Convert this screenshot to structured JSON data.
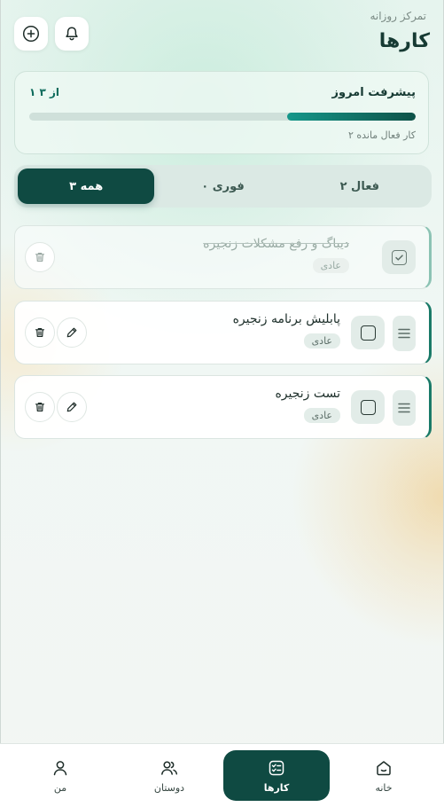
{
  "header": {
    "subtitle": "تمرکز روزانه",
    "title": "کارها",
    "add_icon": "plus-circle-icon",
    "bell_icon": "bell-icon"
  },
  "progress": {
    "title": "پیشرفت امروز",
    "count_text": "۱ از ۳",
    "completed": 1,
    "total": 3,
    "remaining_text": "۲ کار فعال مانده"
  },
  "tabs": [
    {
      "label": "فعال ۲",
      "active": false
    },
    {
      "label": "فوری ۰",
      "active": false
    },
    {
      "label": "همه ۳",
      "active": true
    }
  ],
  "tasks": [
    {
      "title": "دیباگ و رفع مشکلات زنجیره",
      "badge": "عادی",
      "done": true
    },
    {
      "title": "پابلیش برنامه زنجیره",
      "badge": "عادی",
      "done": false
    },
    {
      "title": "تست زنجیره",
      "badge": "عادی",
      "done": false
    }
  ],
  "nav": [
    {
      "label": "خانه",
      "icon": "home-icon",
      "active": false
    },
    {
      "label": "کارها",
      "icon": "tasks-icon",
      "active": true
    },
    {
      "label": "دوستان",
      "icon": "friends-icon",
      "active": false
    },
    {
      "label": "من",
      "icon": "user-icon",
      "active": false
    }
  ],
  "colors": {
    "primary": "#0f4a42",
    "accent": "#1a7a68",
    "progress_track": "#cfe0da"
  }
}
